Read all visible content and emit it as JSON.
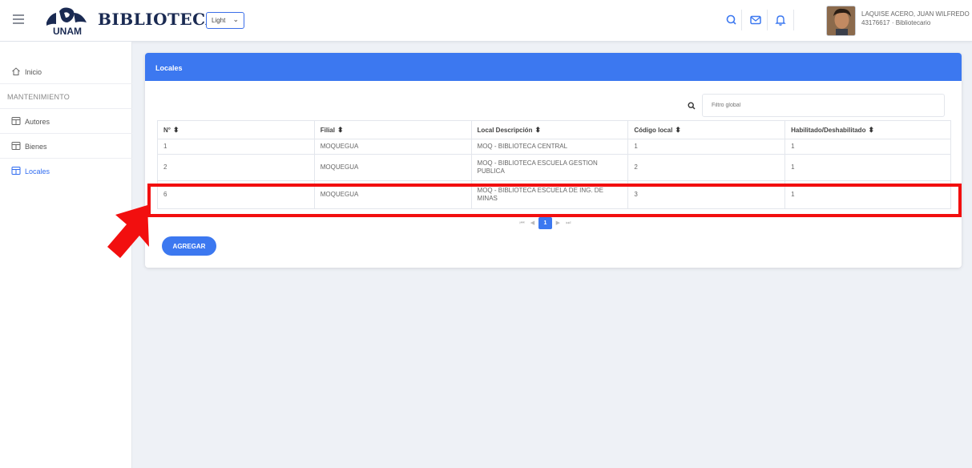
{
  "header": {
    "brand": "BIBLIOTECA",
    "logo_text": "UNAM",
    "theme_select": "Light",
    "user_name": "LAQUISE ACERO, JUAN WILFREDO",
    "user_meta": "43176617 · Bibliotecario",
    "icons": [
      "menu-icon",
      "search-icon",
      "mail-icon",
      "bell-icon"
    ]
  },
  "sidebar": {
    "items": [
      {
        "label": "Inicio",
        "icon": "home-icon"
      },
      {
        "label": "MANTENIMIENTO"
      },
      {
        "label": "Autores",
        "icon": "table-icon"
      },
      {
        "label": "Bienes",
        "icon": "table-icon"
      },
      {
        "label": "Locales",
        "icon": "table-icon"
      }
    ]
  },
  "card": {
    "title": "Locales",
    "filter_placeholder": "Filtro global",
    "columns": [
      "N°",
      "Filial",
      "Local Descripción",
      "Código local",
      "Habilitado/Deshabilitado"
    ],
    "rows": [
      [
        "1",
        "MOQUEGUA",
        "MOQ - BIBLIOTECA CENTRAL",
        "1",
        "1"
      ],
      [
        "2",
        "MOQUEGUA",
        "MOQ - BIBLIOTECA ESCUELA GESTION PUBLICA",
        "2",
        "1"
      ],
      [
        "6",
        "MOQUEGUA",
        "MOQ - BIBLIOTECA ESCUELA DE ING. DE MINAS",
        "3",
        "1"
      ]
    ],
    "pager": {
      "first": "⏮",
      "prev": "◀",
      "current": "1",
      "next": "▶",
      "last": "⏭"
    },
    "add_button": "AGREGAR"
  },
  "colors": {
    "accent": "#3c78f0",
    "highlight": "#f20f0f",
    "brand": "#1a2a52"
  }
}
